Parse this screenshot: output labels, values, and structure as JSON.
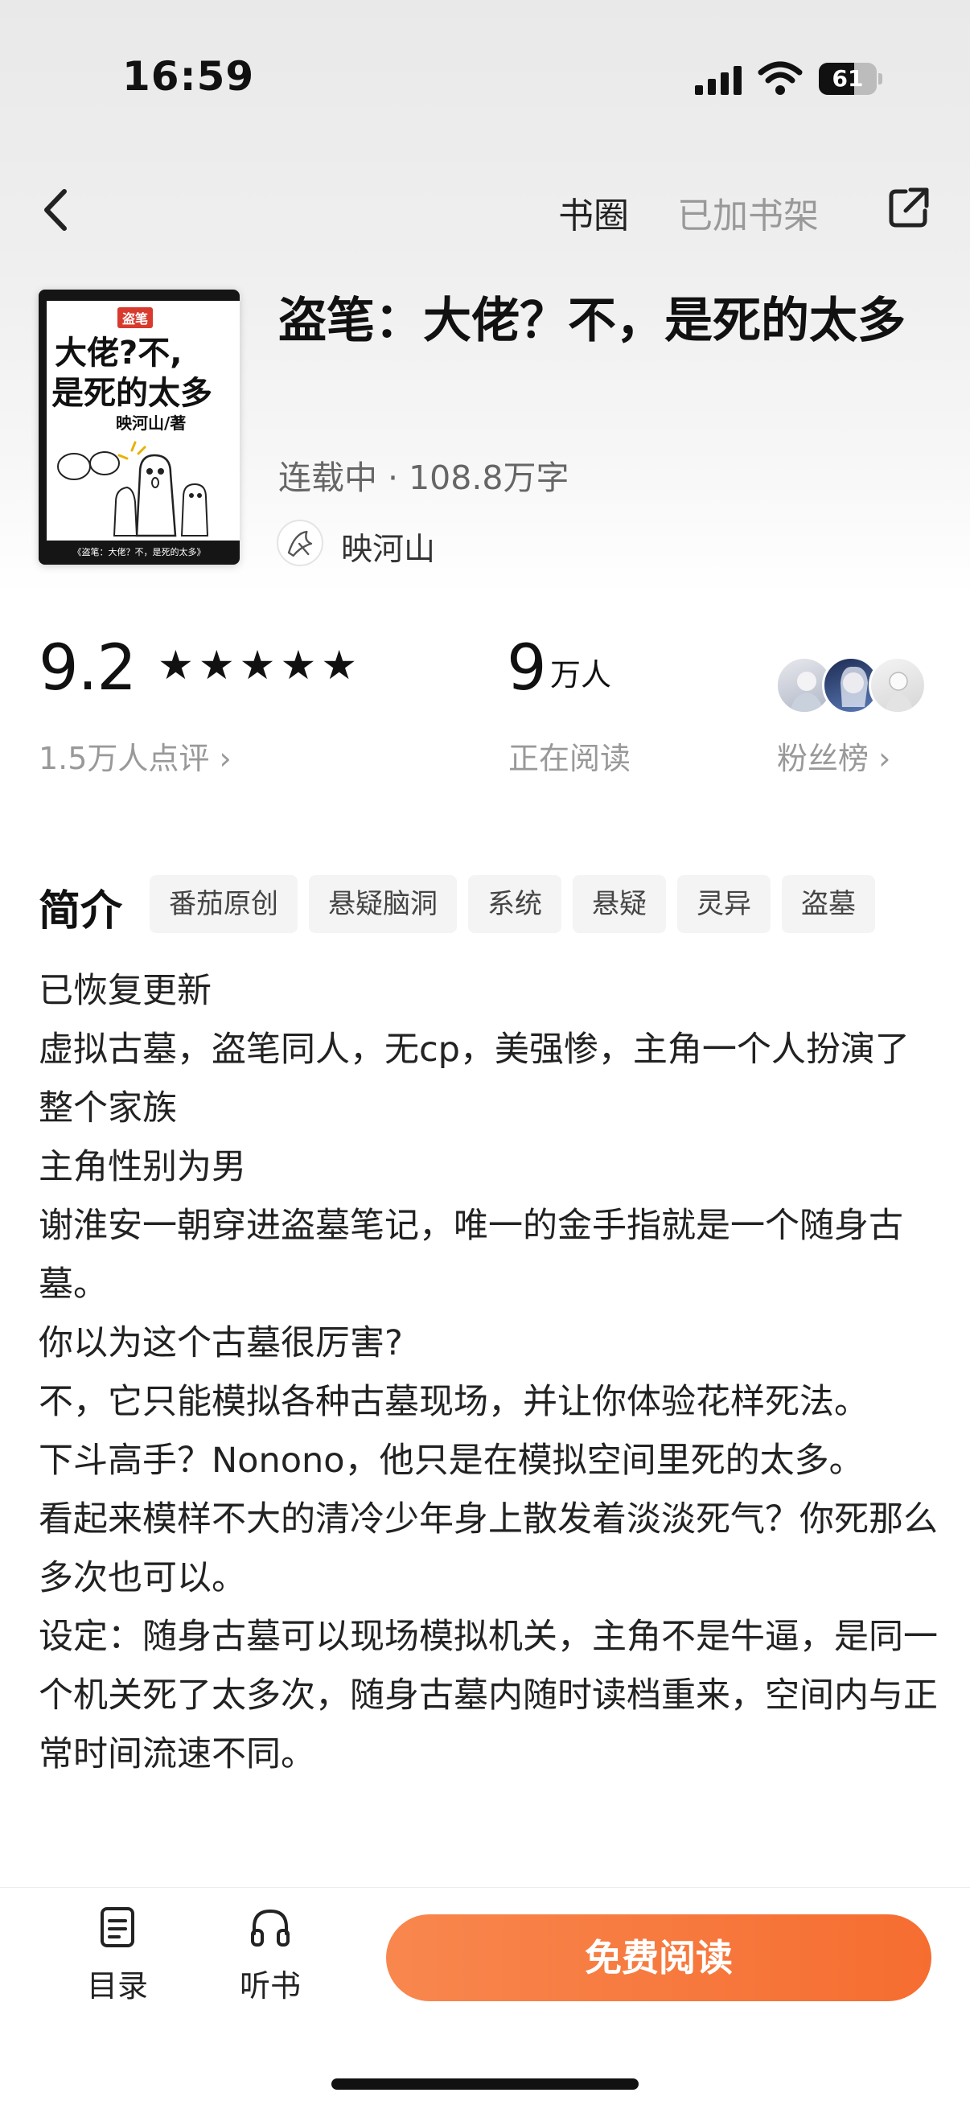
{
  "status_bar": {
    "time": "16:59",
    "battery_level": "61",
    "battery_fraction": 0.61
  },
  "nav": {
    "back_icon": "chevron-left-icon",
    "book_circle": "书圈",
    "added_to_shelf": "已加书架",
    "share_icon": "share-icon"
  },
  "book": {
    "cover": {
      "tag": "盗笔",
      "title_line1": "大佬?不,",
      "title_line2": "是死的太多",
      "author": "映河山/著",
      "bottom_text": "《盗笔：大佬？不，是死的太多》"
    },
    "title": "盗笔：大佬？不，是死的太多",
    "meta": "连载中 · 108.8万字",
    "author": "映河山"
  },
  "stats": {
    "rating": "9.2",
    "stars": "★★★★★",
    "rating_count": "1.5万人点评 ›",
    "readers_value": "9",
    "readers_unit": "万人",
    "readers_label": "正在阅读",
    "fans_label": "粉丝榜 ›"
  },
  "intro": {
    "title": "简介",
    "tags": [
      "番茄原创",
      "悬疑脑洞",
      "系统",
      "悬疑",
      "灵异",
      "盗墓"
    ],
    "lines": [
      "已恢复更新",
      "虚拟古墓，盗笔同人，无cp，美强惨，主角一个人扮演了整个家族",
      "主角性别为男",
      "谢淮安一朝穿进盗墓笔记，唯一的金手指就是一个随身古墓。",
      "你以为这个古墓很厉害?",
      "不，它只能模拟各种古墓现场，并让你体验花样死法。",
      "下斗高手？Nonono，他只是在模拟空间里死的太多。",
      "看起来模样不大的清冷少年身上散发着淡淡死气？你死那么多次也可以。",
      "设定：随身古墓可以现场模拟机关，主角不是牛逼，是同一个机关死了太多次，随身古墓内随时读档重来，空间内与正常时间流速不同。"
    ]
  },
  "bottom_bar": {
    "toc_label": "目录",
    "audio_label": "听书",
    "read_button": "免费阅读"
  },
  "colors": {
    "accent_start": "#f8874e",
    "accent_end": "#f66d30",
    "muted_text": "#999999"
  }
}
